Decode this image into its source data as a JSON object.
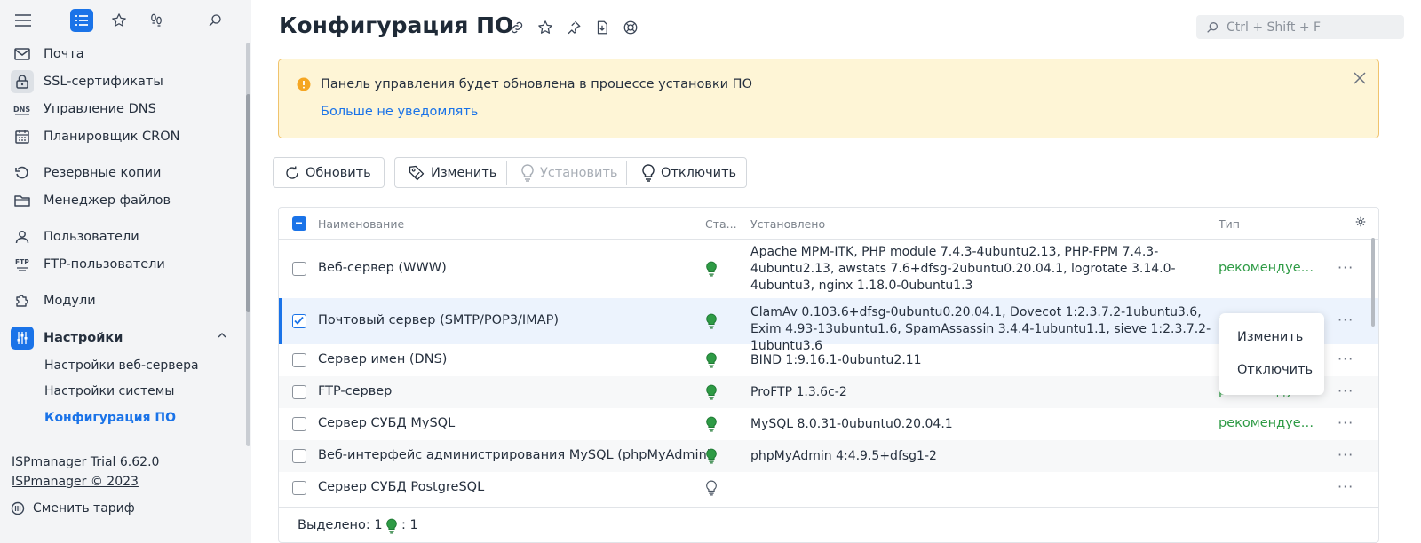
{
  "sidebar": {
    "items": [
      {
        "label": "Почта",
        "icon": "mail-icon"
      },
      {
        "label": "SSL-сертификаты",
        "icon": "lock-icon"
      },
      {
        "label": "Управление DNS",
        "icon": "dns-icon"
      },
      {
        "label": "Планировщик CRON",
        "icon": "calendar-icon"
      },
      {
        "label": "Резервные копии",
        "icon": "backup-icon"
      },
      {
        "label": "Менеджер файлов",
        "icon": "folder-icon"
      },
      {
        "label": "Пользователи",
        "icon": "user-icon"
      },
      {
        "label": "FTP-пользователи",
        "icon": "ftp-icon"
      },
      {
        "label": "Модули",
        "icon": "puzzle-icon"
      },
      {
        "label": "Настройки",
        "icon": "sliders-icon"
      }
    ],
    "subitems": [
      {
        "label": "Настройки веб-сервера"
      },
      {
        "label": "Настройки системы"
      },
      {
        "label": "Конфигурация ПО"
      }
    ],
    "footer": {
      "version": "ISPmanager Trial 6.62.0",
      "copyright": "ISPmanager © 2023",
      "change_plan": "Сменить тариф"
    }
  },
  "header": {
    "title": "Конфигурация ПО",
    "search_placeholder": "Ctrl + Shift + F"
  },
  "banner": {
    "message": "Панель управления будет обновлена в процессе установки ПО",
    "link": "Больше не уведомлять"
  },
  "toolbar": {
    "refresh": "Обновить",
    "edit": "Изменить",
    "install": "Установить",
    "disable": "Отключить"
  },
  "table": {
    "columns": {
      "name": "Наименование",
      "status": "Ста...",
      "installed": "Установлено",
      "type": "Тип"
    },
    "rows": [
      {
        "name": "Веб-сервер (WWW)",
        "installed": "Apache MPM-ITK, PHP module 7.4.3-4ubuntu2.13, PHP-FPM 7.4.3-4ubuntu2.13, awstats 7.6+dfsg-2ubuntu0.20.04.1, logrotate 3.14.0-4ubuntu3, nginx 1.18.0-0ubuntu1.3",
        "type": "рекомендуем...",
        "status_on": true,
        "checked": false
      },
      {
        "name": "Почтовый сервер (SMTP/POP3/IMAP)",
        "installed": "ClamAv 0.103.6+dfsg-0ubuntu0.20.04.1, Dovecot 1:2.3.7.2-1ubuntu3.6, Exim 4.93-13ubuntu1.6, SpamAssassin 3.4.4-1ubuntu1.1, sieve 1:2.3.7.2-1ubuntu3.6",
        "type": "р",
        "status_on": true,
        "checked": true
      },
      {
        "name": "Сервер имен (DNS)",
        "installed": "BIND 1:9.16.1-0ubuntu2.11",
        "type": "р",
        "status_on": true,
        "checked": false
      },
      {
        "name": "FTP-сервер",
        "installed": "ProFTP 1.3.6c-2",
        "type": "рекомендуем",
        "status_on": true,
        "checked": false
      },
      {
        "name": "Сервер СУБД MySQL",
        "installed": "MySQL 8.0.31-0ubuntu0.20.04.1",
        "type": "рекомендуем...",
        "status_on": true,
        "checked": false
      },
      {
        "name": "Веб-интерфейс администрирования MySQL (phpMyAdmin)",
        "installed": "phpMyAdmin 4:4.9.5+dfsg1-2",
        "type": "",
        "status_on": true,
        "checked": false
      },
      {
        "name": "Сервер СУБД PostgreSQL",
        "installed": "",
        "type": "",
        "status_on": false,
        "checked": false
      }
    ],
    "footer": {
      "selected_label": "Выделено: 1",
      "enabled_count": ": 1"
    }
  },
  "context_menu": {
    "edit": "Изменить",
    "disable": "Отключить"
  },
  "colors": {
    "accent": "#1a73e8",
    "success": "#2e9b45",
    "warning_bg": "#fef5d6",
    "warning_border": "#f0c36d"
  }
}
